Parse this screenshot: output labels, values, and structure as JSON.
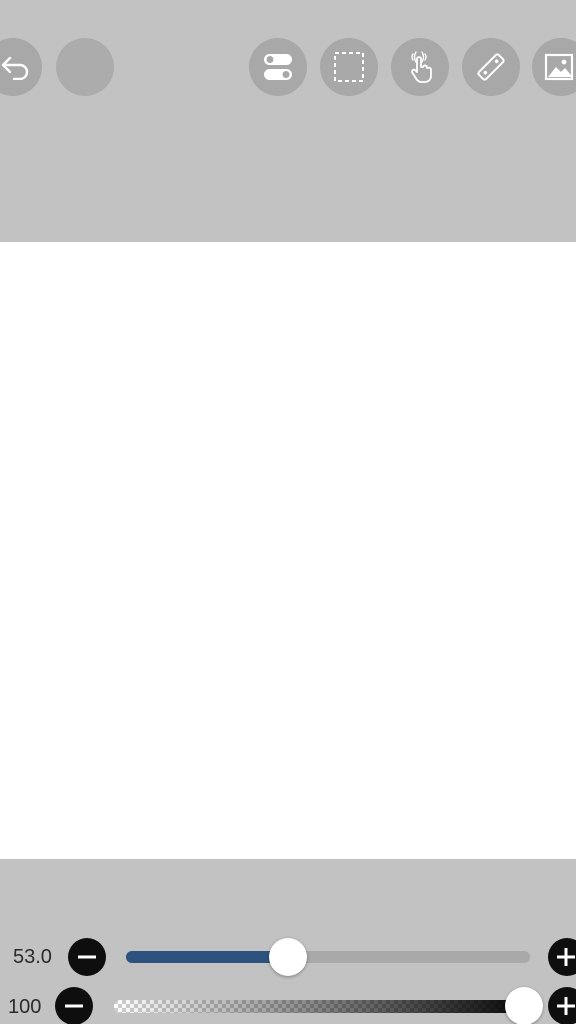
{
  "toolbar": {
    "icons": [
      "undo-icon",
      "redo-icon",
      "toggle-switches-icon",
      "selection-icon",
      "hand-touch-icon",
      "ruler-icon",
      "image-icon"
    ]
  },
  "brush": {
    "size_value": "53.0",
    "size_fraction": 0.4,
    "opacity_value": "100",
    "opacity_fraction": 1.0,
    "size_fill_color": "#2d527f"
  }
}
